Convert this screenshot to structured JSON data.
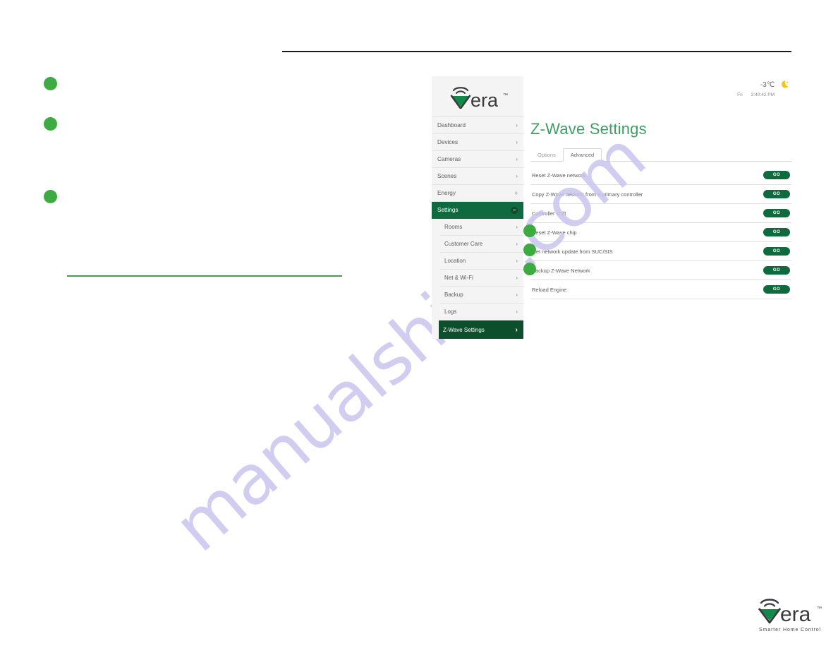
{
  "brand": {
    "name": "vera",
    "trademark": "™",
    "tagline": "Smarter Home Control",
    "logo_icon": "vera-wifi-triangle-logo",
    "green": "#0f8a4a",
    "dark": "#3a3a3a"
  },
  "watermark": {
    "text": "manualshive.com"
  },
  "colors": {
    "accent_green": "#3cab40",
    "title_green": "#3f9e63",
    "nav_active_green": "#0f6b3f",
    "subnav_selected_green": "#0d4f2c",
    "go_button_green": "#0e6b3d",
    "rule_green": "#4a9a52",
    "top_rule": "#1c1c1c",
    "watermark_purple": "#c9c5ee"
  },
  "sidebar": {
    "items": [
      {
        "label": "Dashboard",
        "icon": "chevron-right-icon",
        "state": "normal"
      },
      {
        "label": "Devices",
        "icon": "chevron-right-icon",
        "state": "normal"
      },
      {
        "label": "Cameras",
        "icon": "chevron-right-icon",
        "state": "normal"
      },
      {
        "label": "Scenes",
        "icon": "chevron-right-icon",
        "state": "normal"
      },
      {
        "label": "Energy",
        "icon": "plus-icon",
        "state": "normal"
      },
      {
        "label": "Settings",
        "icon": "minus-icon",
        "state": "expanded"
      }
    ],
    "subitems": [
      {
        "label": "Rooms",
        "icon": "chevron-right-icon",
        "selected": false
      },
      {
        "label": "Customer Care",
        "icon": "chevron-right-icon",
        "selected": false
      },
      {
        "label": "Location",
        "icon": "chevron-right-icon",
        "selected": false
      },
      {
        "label": "Net & Wi-Fi",
        "icon": "chevron-right-icon",
        "selected": false
      },
      {
        "label": "Backup",
        "icon": "chevron-right-icon",
        "selected": false
      },
      {
        "label": "Logs",
        "icon": "chevron-right-icon",
        "selected": false
      },
      {
        "label": "Z-Wave Settings",
        "icon": "chevron-right-icon",
        "selected": true
      }
    ]
  },
  "weather": {
    "temperature": "-3℃",
    "icon": "moon-icon",
    "day": "Fri",
    "time": "3:40:42 PM"
  },
  "main": {
    "title": "Z-Wave Settings",
    "tabs": [
      {
        "label": "Options",
        "active": false
      },
      {
        "label": "Advanced",
        "active": true
      }
    ],
    "action_button_label": "GO",
    "rows": [
      {
        "label": "Reset Z-Wave network",
        "button": "GO",
        "marked": false
      },
      {
        "label": "Copy Z-Wave network from a primary controller",
        "button": "GO",
        "marked": false
      },
      {
        "label": "Controller shift",
        "button": "GO",
        "marked": false
      },
      {
        "label": "Reset Z-Wave chip",
        "button": "GO",
        "marked": true
      },
      {
        "label": "Get network update from SUC/SIS",
        "button": "GO",
        "marked": true
      },
      {
        "label": "Backup Z-Wave Network",
        "button": "GO",
        "marked": true
      },
      {
        "label": "Reload Engine",
        "button": "GO",
        "marked": false
      }
    ]
  },
  "annotations": {
    "bullets": [
      {
        "id": "callout-1"
      },
      {
        "id": "callout-2"
      },
      {
        "id": "callout-3"
      }
    ]
  }
}
